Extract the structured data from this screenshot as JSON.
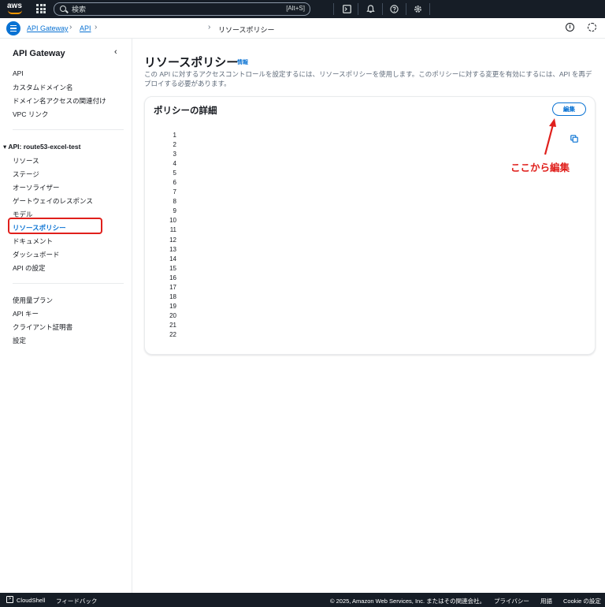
{
  "topnav": {
    "logo_text": "aws",
    "search_placeholder": "検索",
    "search_shortcut": "[Alt+S]",
    "icons": [
      "cloudshell-icon",
      "bell-icon",
      "help-icon",
      "settings-icon"
    ]
  },
  "breadcrumb": {
    "items": [
      "API Gateway",
      "API"
    ],
    "current": "リソースポリシー"
  },
  "sidebar": {
    "title": "API Gateway",
    "top_items": [
      "API",
      "カスタムドメイン名",
      "ドメイン名アクセスの関連付け",
      "VPC リンク"
    ],
    "api_section": "API: route53-excel-test",
    "api_items": [
      "リソース",
      "ステージ",
      "オーソライザー",
      "ゲートウェイのレスポンス",
      "モデル",
      "リソースポリシー",
      "ドキュメント",
      "ダッシュボード",
      "API の設定"
    ],
    "active_item": "リソースポリシー",
    "bottom_items": [
      "使用量プラン",
      "API キー",
      "クライアント証明書",
      "設定"
    ]
  },
  "main": {
    "title": "リソースポリシー",
    "info_label": "情報",
    "description": "この API に対するアクセスコントロールを設定するには、リソースポリシーを使用します。このポリシーに対する変更を有効にするには、API を再デプロイする必要があります。",
    "panel": {
      "title": "ポリシーの詳細",
      "edit_label": "編集",
      "line_numbers": [
        "1",
        "2",
        "3",
        "4",
        "5",
        "6",
        "7",
        "8",
        "9",
        "10",
        "11",
        "12",
        "13",
        "14",
        "15",
        "16",
        "17",
        "18",
        "19",
        "20",
        "21",
        "22"
      ]
    },
    "annotation": "ここから編集"
  },
  "footer": {
    "cloudshell": "CloudShell",
    "feedback": "フィードバック",
    "copyright": "© 2025, Amazon Web Services, Inc. またはその関連会社。",
    "privacy": "プライバシー",
    "terms": "用語",
    "cookie": "Cookie の設定"
  },
  "colors": {
    "nav_bg": "#161d26",
    "link": "#0972d3",
    "annotation_red": "#e0201c"
  }
}
